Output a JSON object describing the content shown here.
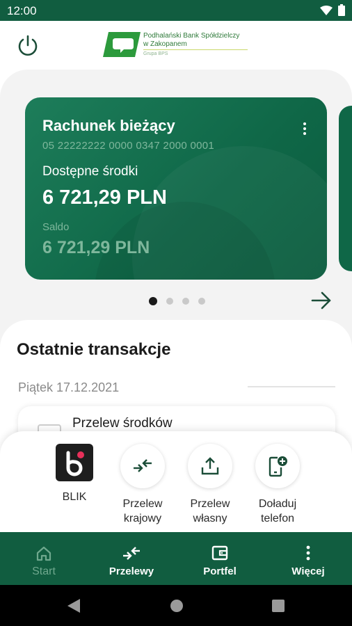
{
  "status_bar": {
    "time": "12:00",
    "icons": [
      "wifi-icon",
      "battery-icon"
    ]
  },
  "header": {
    "power_icon": "power-icon",
    "logo": {
      "line1": "Podhalański Bank Spółdzielczy",
      "line2": "w Zakopanem",
      "line3": "Grupa BPS"
    }
  },
  "account_card": {
    "title": "Rachunek bieżący",
    "number": "05 22222222 0000 0347 2000 0001",
    "available_label": "Dostępne środki",
    "available_value": "6 721,29 PLN",
    "balance_label": "Saldo",
    "balance_value": "6 721,29 PLN",
    "menu_icon": "more-vertical-icon"
  },
  "pager": {
    "count": 4,
    "active": 0
  },
  "transactions": {
    "title": "Ostatnie transakcje",
    "date": "Piątek 17.12.2021",
    "items": [
      {
        "label": "Przelew środków"
      }
    ]
  },
  "quick_actions": [
    {
      "label": "BLIK",
      "icon": "blik-icon"
    },
    {
      "label_line1": "Przelew",
      "label_line2": "krajowy",
      "icon": "transfer-arrows-icon"
    },
    {
      "label_line1": "Przelew",
      "label_line2": "własny",
      "icon": "upload-icon"
    },
    {
      "label_line1": "Doładuj",
      "label_line2": "telefon",
      "icon": "phone-topup-icon"
    }
  ],
  "bottom_nav": [
    {
      "label": "Start",
      "icon": "home-icon",
      "active": true
    },
    {
      "label": "Przelewy",
      "icon": "transfer-arrows-icon"
    },
    {
      "label": "Portfel",
      "icon": "wallet-icon"
    },
    {
      "label": "Więcej",
      "icon": "more-vertical-icon"
    }
  ],
  "colors": {
    "primary": "#115d40",
    "card": "#0f6747",
    "muted_green": "#7fb79c",
    "blik_dot": "#e8305a"
  }
}
